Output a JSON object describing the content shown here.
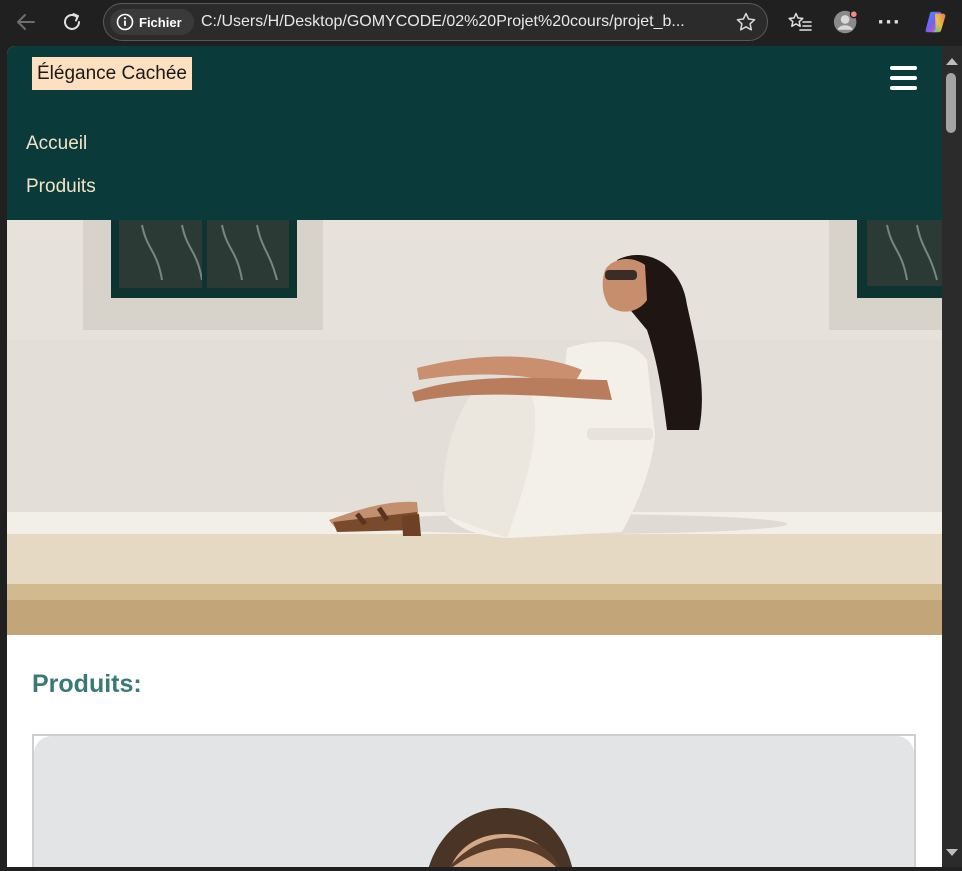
{
  "browser": {
    "security_chip_label": "Fichier",
    "url": "C:/Users/H/Desktop/GOMYCODE/02%20Projet%20cours/projet_b...",
    "icons": [
      "back-arrow-icon",
      "reload-icon",
      "info-icon",
      "favorite-star-icon",
      "favorites-list-icon",
      "profile-avatar-icon",
      "more-menu-icon",
      "copilot-icon"
    ]
  },
  "site": {
    "logo": "Élégance Cachée",
    "nav": {
      "items": [
        {
          "label": "Accueil"
        },
        {
          "label": "Produits"
        }
      ]
    },
    "products_title": "Produits:"
  },
  "colors": {
    "header_bg": "#0a3a3a",
    "logo_bg": "#fde0c0",
    "nav_text": "#f3e3c6",
    "title_text": "#3b7a74"
  }
}
